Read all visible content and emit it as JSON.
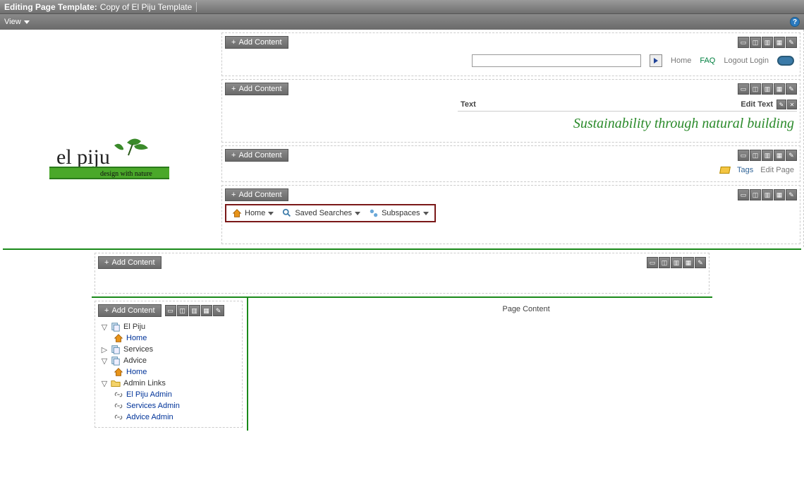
{
  "titlebar": {
    "label": "Editing Page Template:",
    "name": "Copy of El Piju Template"
  },
  "toolbar": {
    "view": "View"
  },
  "buttons": {
    "add_content": "Add Content"
  },
  "topnav": {
    "search_placeholder": "",
    "home": "Home",
    "faq": "FAQ",
    "logout_login": "Logout Login"
  },
  "text_portlet": {
    "title": "Text",
    "edit": "Edit Text",
    "content": "Sustainability through natural building"
  },
  "tags_row": {
    "tags": "Tags",
    "edit_page": "Edit Page"
  },
  "menubar": {
    "home": "Home",
    "saved": "Saved Searches",
    "subspaces": "Subspaces"
  },
  "page_content_label": "Page Content",
  "tree": {
    "root": "El Piju",
    "root_home": "Home",
    "services": "Services",
    "advice": "Advice",
    "advice_home": "Home",
    "admin_links": "Admin Links",
    "el_piju_admin": "El Piju Admin",
    "services_admin": "Services Admin",
    "advice_admin": "Advice Admin"
  },
  "logo": {
    "name": "el piju",
    "tag": "design with nature"
  }
}
